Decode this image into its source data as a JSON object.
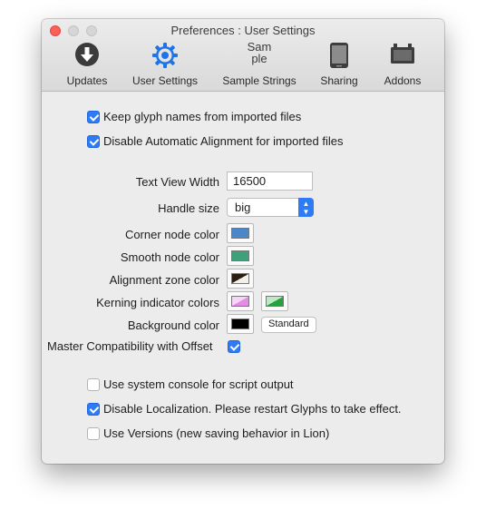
{
  "window": {
    "title": "Preferences : User Settings"
  },
  "toolbar": {
    "items": [
      {
        "label": "Updates",
        "icon": "download-icon"
      },
      {
        "label": "User Settings",
        "icon": "gear-icon"
      },
      {
        "label": "Sample Strings",
        "icon": "sample-text-icon",
        "icon_text_1": "Sam",
        "icon_text_2": "ple"
      },
      {
        "label": "Sharing",
        "icon": "phone-device-icon"
      },
      {
        "label": "Addons",
        "icon": "package-box-icon"
      }
    ]
  },
  "settings": {
    "keep_glyph_names": {
      "label": "Keep glyph names from imported files",
      "checked": true
    },
    "disable_alignment": {
      "label": "Disable Automatic Alignment for imported files",
      "checked": true
    },
    "text_view_width": {
      "label": "Text View Width",
      "value": "16500"
    },
    "handle_size": {
      "label": "Handle size",
      "value": "big"
    },
    "corner_node_color": {
      "label": "Corner node color",
      "color": "#4a86c8"
    },
    "smooth_node_color": {
      "label": "Smooth node color",
      "color": "#3fa07a"
    },
    "alignment_zone_color": {
      "label": "Alignment zone color"
    },
    "kerning_indicator_colors": {
      "label": "Kerning indicator colors",
      "color1": "#e58be6",
      "color2": "#25a23c"
    },
    "background_color": {
      "label": "Background color",
      "color": "#000000",
      "button": "Standard"
    },
    "master_compatibility": {
      "label": "Master Compatibility with Offset",
      "checked": true
    },
    "system_console": {
      "label": "Use system console for script output",
      "checked": false
    },
    "disable_localization": {
      "label": "Disable Localization. Please restart Glyphs to take effect.",
      "checked": true
    },
    "use_versions": {
      "label": "Use Versions (new saving behavior in Lion)",
      "checked": false
    }
  },
  "accent": "#2f7bf5"
}
